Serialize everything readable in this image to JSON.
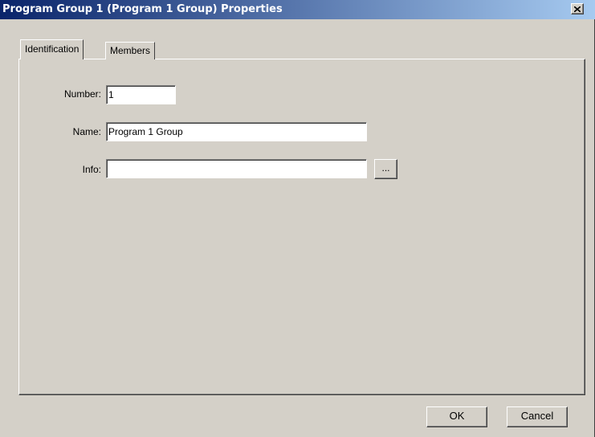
{
  "window": {
    "title": "Program Group 1 (Program 1 Group) Properties",
    "close_glyph": "✕"
  },
  "tabs": [
    {
      "label": "Identification",
      "active": true
    },
    {
      "label": "Members",
      "active": false
    }
  ],
  "form": {
    "number_label": "Number:",
    "number_value": "1",
    "name_label": "Name:",
    "name_value": "Program 1 Group",
    "info_label": "Info:",
    "info_value": "",
    "browse_label": "..."
  },
  "footer": {
    "ok_label": "OK",
    "cancel_label": "Cancel"
  }
}
